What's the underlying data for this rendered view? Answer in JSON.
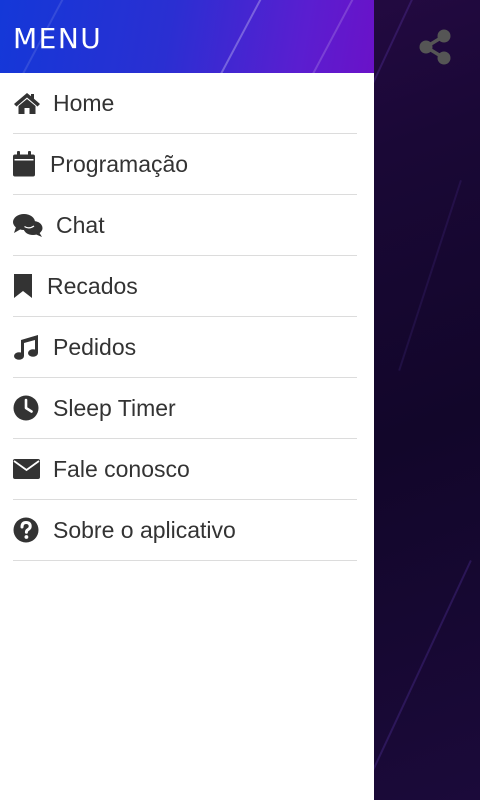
{
  "drawer": {
    "title": "MENU",
    "items": [
      {
        "label": "Home",
        "icon": "home-icon"
      },
      {
        "label": "Programação",
        "icon": "calendar-icon"
      },
      {
        "label": "Chat",
        "icon": "chat-icon"
      },
      {
        "label": "Recados",
        "icon": "bookmark-icon"
      },
      {
        "label": "Pedidos",
        "icon": "music-icon"
      },
      {
        "label": "Sleep Timer",
        "icon": "clock-icon"
      },
      {
        "label": "Fale conosco",
        "icon": "envelope-icon"
      },
      {
        "label": "Sobre o aplicativo",
        "icon": "question-icon"
      }
    ]
  },
  "share": {
    "icon": "share-icon"
  },
  "colors": {
    "header_gradient_start": "#1438d8",
    "header_gradient_end": "#6a12c8",
    "menu_text": "#333333",
    "divider": "#dcdcdc",
    "background_dark": "#12062a",
    "share_icon": "#555555"
  }
}
